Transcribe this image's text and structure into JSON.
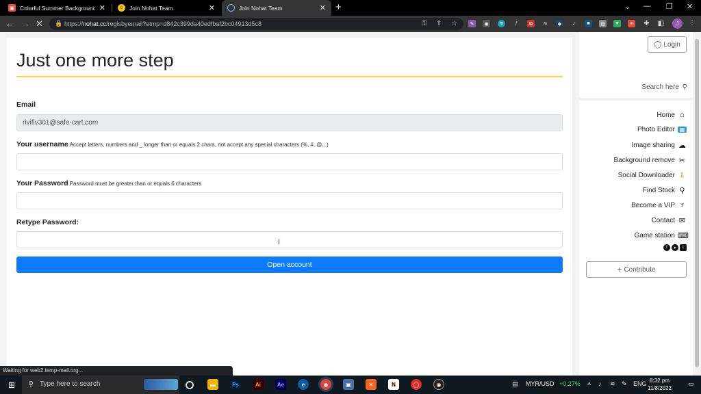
{
  "browser": {
    "tabs": [
      {
        "title": "Colorful Summer Background Le"
      },
      {
        "title": "Join Nohat Team"
      },
      {
        "title": "Join Nohat Team"
      }
    ],
    "url_prefix": "https://",
    "url_domain": "nohat.cc",
    "url_path": "/regisbyemail?etmp=d842c399da40edfbaf2bc04913d5c8"
  },
  "form": {
    "heading": "Just one more step",
    "email_label": "Email",
    "email_value": "rivifiv301@safe-cart.com",
    "username_label": "Your username",
    "username_hint": "Accept letters, numbers and _ longer than or equals 2 chars, not accept any special characters (%, #, @...)",
    "password_label": "Your Password",
    "password_hint": "Password must be greater than or equals 6 characters",
    "retype_label": "Retype Password:",
    "submit": "Open account"
  },
  "sidebar": {
    "login": "Login",
    "search": "Search here",
    "items": [
      {
        "label": "Home",
        "icon": "home-icon"
      },
      {
        "label": "Photo Editor",
        "icon": "photo-editor-icon"
      },
      {
        "label": "Image sharing",
        "icon": "cloud-upload-icon"
      },
      {
        "label": "Background remove",
        "icon": "scissors-icon"
      },
      {
        "label": "Social Downloader",
        "icon": "download-icon"
      },
      {
        "label": "Find Stock",
        "icon": "search-icon"
      },
      {
        "label": "Become a VIP",
        "icon": "medal-icon"
      },
      {
        "label": "Contact",
        "icon": "envelope-icon"
      },
      {
        "label": "Game station",
        "icon": "gamepad-icon"
      }
    ],
    "contribute": "Contribute"
  },
  "status_text": "Waiting for web2.temp-mail.org...",
  "taskbar": {
    "search_placeholder": "Type here to search",
    "currency": "MYR/USD",
    "currency_change": "+0.27%",
    "lang": "ENG",
    "time": "8:32 pm",
    "date": "11/8/2022"
  }
}
